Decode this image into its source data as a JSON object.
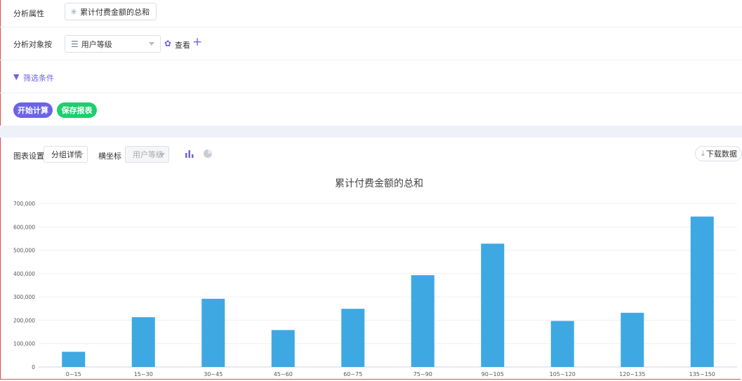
{
  "form": {
    "attr_label": "分析属性",
    "attr_value": "累计付费金额的总和",
    "group_label": "分析对象按",
    "group_value": "用户等级",
    "view_label": "查看",
    "filter_label": "筛选条件",
    "start_button": "开始计算",
    "save_button": "保存报表"
  },
  "toolbar": {
    "chart_settings_label": "图表设置",
    "group_detail": "分组详情",
    "x_axis_label": "横坐标",
    "x_axis_value": "用户等级",
    "download_label": "下载数据"
  },
  "colors": {
    "accent": "#6c63e8",
    "save_green": "#1ccf6e",
    "bar": "#3ea8e2"
  },
  "chart_data": {
    "type": "bar",
    "title": "累计付费金额的总和",
    "categories": [
      "0~15",
      "15~30",
      "30~45",
      "45~60",
      "60~75",
      "75~90",
      "90~105",
      "105~120",
      "120~135",
      "135~150"
    ],
    "values": [
      65000,
      213000,
      292000,
      158000,
      249000,
      393000,
      528000,
      197000,
      232000,
      644000
    ],
    "ylim": [
      0,
      700000
    ],
    "yticks": [
      "0",
      "100,000",
      "200,000",
      "300,000",
      "400,000",
      "500,000",
      "600,000",
      "700,000"
    ],
    "grid": true
  }
}
